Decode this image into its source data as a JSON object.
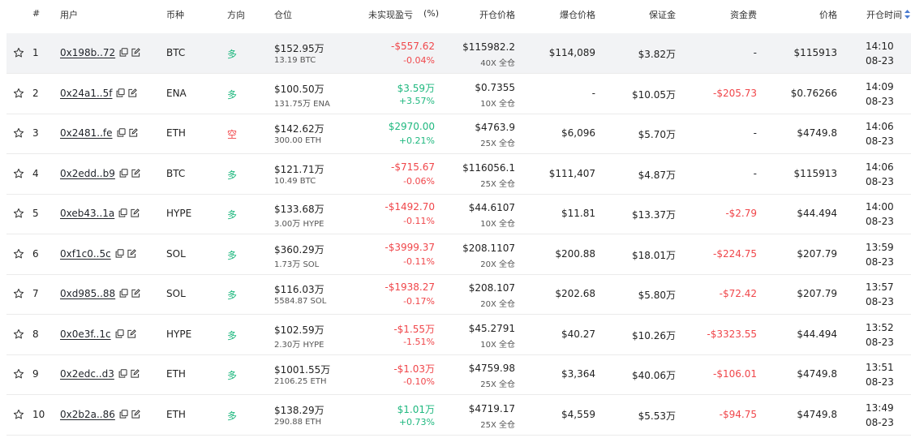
{
  "colors": {
    "positive": "#1fb87f",
    "negative": "#f0464a",
    "highlight_row": "#f2f3f5"
  },
  "header": {
    "index": "#",
    "user": "用户",
    "coin": "币种",
    "direction": "方向",
    "position": "仓位",
    "pnl": "未实现盈亏",
    "pnl_pct": "(%)",
    "entry_price": "开仓价格",
    "liq_price": "爆仓价格",
    "margin": "保证金",
    "funding": "资金费",
    "price": "价格",
    "open_time": "开仓时间"
  },
  "rows": [
    {
      "idx": "1",
      "user": "0x198b..72",
      "coin": "BTC",
      "dir": "多",
      "dir_type": "long",
      "pos": "$152.95万",
      "size": "13.19 BTC",
      "pnl": "-$557.62",
      "pnl_pct": "-0.04%",
      "pnl_sign": "neg",
      "entry": "$115982.2",
      "lev": "40X 全仓",
      "liq": "$114,089",
      "margin": "$3.82万",
      "funding": "-",
      "funding_sign": "none",
      "price": "$115913",
      "time": "14:10",
      "date": "08-23"
    },
    {
      "idx": "2",
      "user": "0x24a1..5f",
      "coin": "ENA",
      "dir": "多",
      "dir_type": "long",
      "pos": "$100.50万",
      "size": "131.75万 ENA",
      "pnl": "$3.59万",
      "pnl_pct": "+3.57%",
      "pnl_sign": "pos",
      "entry": "$0.7355",
      "lev": "10X 全仓",
      "liq": "-",
      "margin": "$10.05万",
      "funding": "-$205.73",
      "funding_sign": "neg",
      "price": "$0.76266",
      "time": "14:09",
      "date": "08-23"
    },
    {
      "idx": "3",
      "user": "0x2481..fe",
      "coin": "ETH",
      "dir": "空",
      "dir_type": "short",
      "pos": "$142.62万",
      "size": "300.00 ETH",
      "pnl": "$2970.00",
      "pnl_pct": "+0.21%",
      "pnl_sign": "pos",
      "entry": "$4763.9",
      "lev": "25X 全仓",
      "liq": "$6,096",
      "margin": "$5.70万",
      "funding": "-",
      "funding_sign": "none",
      "price": "$4749.8",
      "time": "14:06",
      "date": "08-23"
    },
    {
      "idx": "4",
      "user": "0x2edd..b9",
      "coin": "BTC",
      "dir": "多",
      "dir_type": "long",
      "pos": "$121.71万",
      "size": "10.49 BTC",
      "pnl": "-$715.67",
      "pnl_pct": "-0.06%",
      "pnl_sign": "neg",
      "entry": "$116056.1",
      "lev": "25X 全仓",
      "liq": "$111,407",
      "margin": "$4.87万",
      "funding": "-",
      "funding_sign": "none",
      "price": "$115913",
      "time": "14:06",
      "date": "08-23"
    },
    {
      "idx": "5",
      "user": "0xeb43..1a",
      "coin": "HYPE",
      "dir": "多",
      "dir_type": "long",
      "pos": "$133.68万",
      "size": "3.00万 HYPE",
      "pnl": "-$1492.70",
      "pnl_pct": "-0.11%",
      "pnl_sign": "neg",
      "entry": "$44.6107",
      "lev": "10X 全仓",
      "liq": "$11.81",
      "margin": "$13.37万",
      "funding": "-$2.79",
      "funding_sign": "neg",
      "price": "$44.494",
      "time": "14:00",
      "date": "08-23"
    },
    {
      "idx": "6",
      "user": "0xf1c0..5c",
      "coin": "SOL",
      "dir": "多",
      "dir_type": "long",
      "pos": "$360.29万",
      "size": "1.73万 SOL",
      "pnl": "-$3999.37",
      "pnl_pct": "-0.11%",
      "pnl_sign": "neg",
      "entry": "$208.1107",
      "lev": "20X 全仓",
      "liq": "$200.88",
      "margin": "$18.01万",
      "funding": "-$224.75",
      "funding_sign": "neg",
      "price": "$207.79",
      "time": "13:59",
      "date": "08-23"
    },
    {
      "idx": "7",
      "user": "0xd985..88",
      "coin": "SOL",
      "dir": "多",
      "dir_type": "long",
      "pos": "$116.03万",
      "size": "5584.87 SOL",
      "pnl": "-$1938.27",
      "pnl_pct": "-0.17%",
      "pnl_sign": "neg",
      "entry": "$208.107",
      "lev": "20X 全仓",
      "liq": "$202.68",
      "margin": "$5.80万",
      "funding": "-$72.42",
      "funding_sign": "neg",
      "price": "$207.79",
      "time": "13:57",
      "date": "08-23"
    },
    {
      "idx": "8",
      "user": "0x0e3f..1c",
      "coin": "HYPE",
      "dir": "多",
      "dir_type": "long",
      "pos": "$102.59万",
      "size": "2.30万 HYPE",
      "pnl": "-$1.55万",
      "pnl_pct": "-1.51%",
      "pnl_sign": "neg",
      "entry": "$45.2791",
      "lev": "10X 全仓",
      "liq": "$40.27",
      "margin": "$10.26万",
      "funding": "-$3323.55",
      "funding_sign": "neg",
      "price": "$44.494",
      "time": "13:52",
      "date": "08-23"
    },
    {
      "idx": "9",
      "user": "0x2edc..d3",
      "coin": "ETH",
      "dir": "多",
      "dir_type": "long",
      "pos": "$1001.55万",
      "size": "2106.25 ETH",
      "pnl": "-$1.03万",
      "pnl_pct": "-0.10%",
      "pnl_sign": "neg",
      "entry": "$4759.98",
      "lev": "25X 全仓",
      "liq": "$3,364",
      "margin": "$40.06万",
      "funding": "-$106.01",
      "funding_sign": "neg",
      "price": "$4749.8",
      "time": "13:51",
      "date": "08-23"
    },
    {
      "idx": "10",
      "user": "0x2b2a..86",
      "coin": "ETH",
      "dir": "多",
      "dir_type": "long",
      "pos": "$138.29万",
      "size": "290.88 ETH",
      "pnl": "$1.01万",
      "pnl_pct": "+0.73%",
      "pnl_sign": "pos",
      "entry": "$4719.17",
      "lev": "25X 全仓",
      "liq": "$4,559",
      "margin": "$5.53万",
      "funding": "-$94.75",
      "funding_sign": "neg",
      "price": "$4749.8",
      "time": "13:49",
      "date": "08-23"
    }
  ]
}
